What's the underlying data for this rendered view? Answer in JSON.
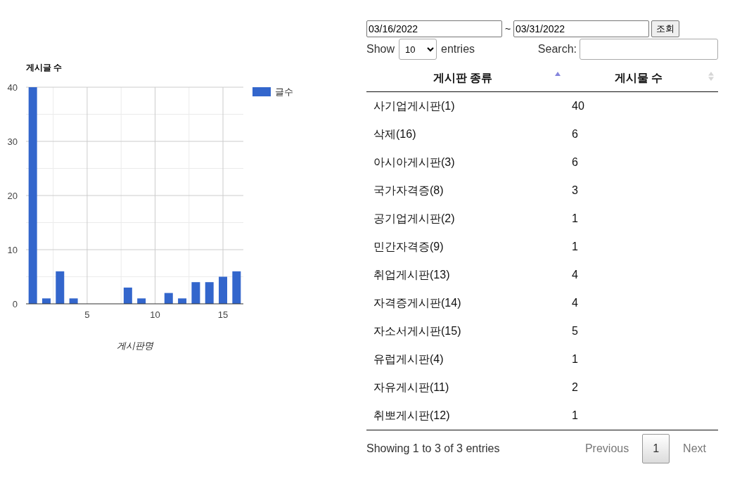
{
  "chart": {
    "chart_data": {
      "type": "bar",
      "title": "게시글 수",
      "xlabel": "게시판명",
      "x": [
        1,
        2,
        3,
        4,
        8,
        9,
        11,
        12,
        13,
        14,
        15,
        16
      ],
      "series": [
        {
          "name": "글수",
          "color": "#3366cc",
          "values": [
            40,
            1,
            6,
            1,
            3,
            1,
            2,
            1,
            4,
            4,
            5,
            6
          ]
        }
      ],
      "xlim": [
        0.5,
        16.5
      ],
      "ylim": [
        0,
        40
      ],
      "xticks": [
        5,
        10,
        15
      ],
      "yticks": [
        0,
        10,
        20,
        30,
        40
      ],
      "grid": true
    }
  },
  "filter": {
    "start_date": "03/16/2022",
    "separator": "~",
    "end_date": "03/31/2022",
    "button": "조회"
  },
  "length_menu": {
    "prefix": "Show",
    "value": "10",
    "suffix": "entries"
  },
  "search": {
    "label": "Search:"
  },
  "table": {
    "columns": [
      {
        "label": "게시판 종류",
        "sorted": true
      },
      {
        "label": "게시물 수",
        "sorted": false
      }
    ],
    "rows": [
      [
        "사기업게시판(1)",
        "40"
      ],
      [
        "삭제(16)",
        "6"
      ],
      [
        "아시아게시판(3)",
        "6"
      ],
      [
        "국가자격증(8)",
        "3"
      ],
      [
        "공기업게시판(2)",
        "1"
      ],
      [
        "민간자격증(9)",
        "1"
      ],
      [
        "취업게시판(13)",
        "4"
      ],
      [
        "자격증게시판(14)",
        "4"
      ],
      [
        "자소서게시판(15)",
        "5"
      ],
      [
        "유럽게시판(4)",
        "1"
      ],
      [
        "자유게시판(11)",
        "2"
      ],
      [
        "취뽀게시판(12)",
        "1"
      ]
    ]
  },
  "info": "Showing 1 to 3 of 3 entries",
  "pagination": {
    "previous": {
      "label": "Previous",
      "disabled": true
    },
    "pages": [
      {
        "label": "1",
        "selected": true
      }
    ],
    "next": {
      "label": "Next",
      "disabled": true
    }
  }
}
